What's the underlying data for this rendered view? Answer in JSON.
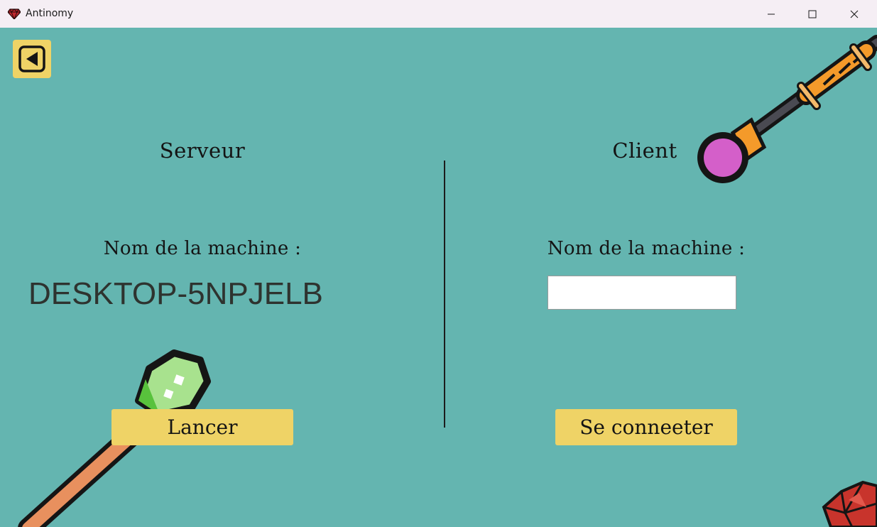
{
  "window": {
    "title": "Antinomy",
    "icon": "red-gem-icon",
    "controls": [
      "minimize-icon",
      "maximize-icon",
      "close-icon"
    ]
  },
  "nav": {
    "back_icon": "back-arrow-icon"
  },
  "server": {
    "heading": "Serveur",
    "machine_label": "Nom de la machine :",
    "machine_name": "DESKTOP-5NPJELB",
    "launch_label": "Lancer"
  },
  "client": {
    "heading": "Client",
    "machine_label": "Nom de la machine :",
    "machine_input_value": "",
    "connect_label": "Se conneeter"
  },
  "decorations": [
    "orange-wand-icon",
    "green-crystal-wand-icon",
    "red-gem-cluster-icon"
  ],
  "colors": {
    "background": "#64b5b0",
    "button": "#efd366",
    "titlebar": "#f5eef4"
  }
}
